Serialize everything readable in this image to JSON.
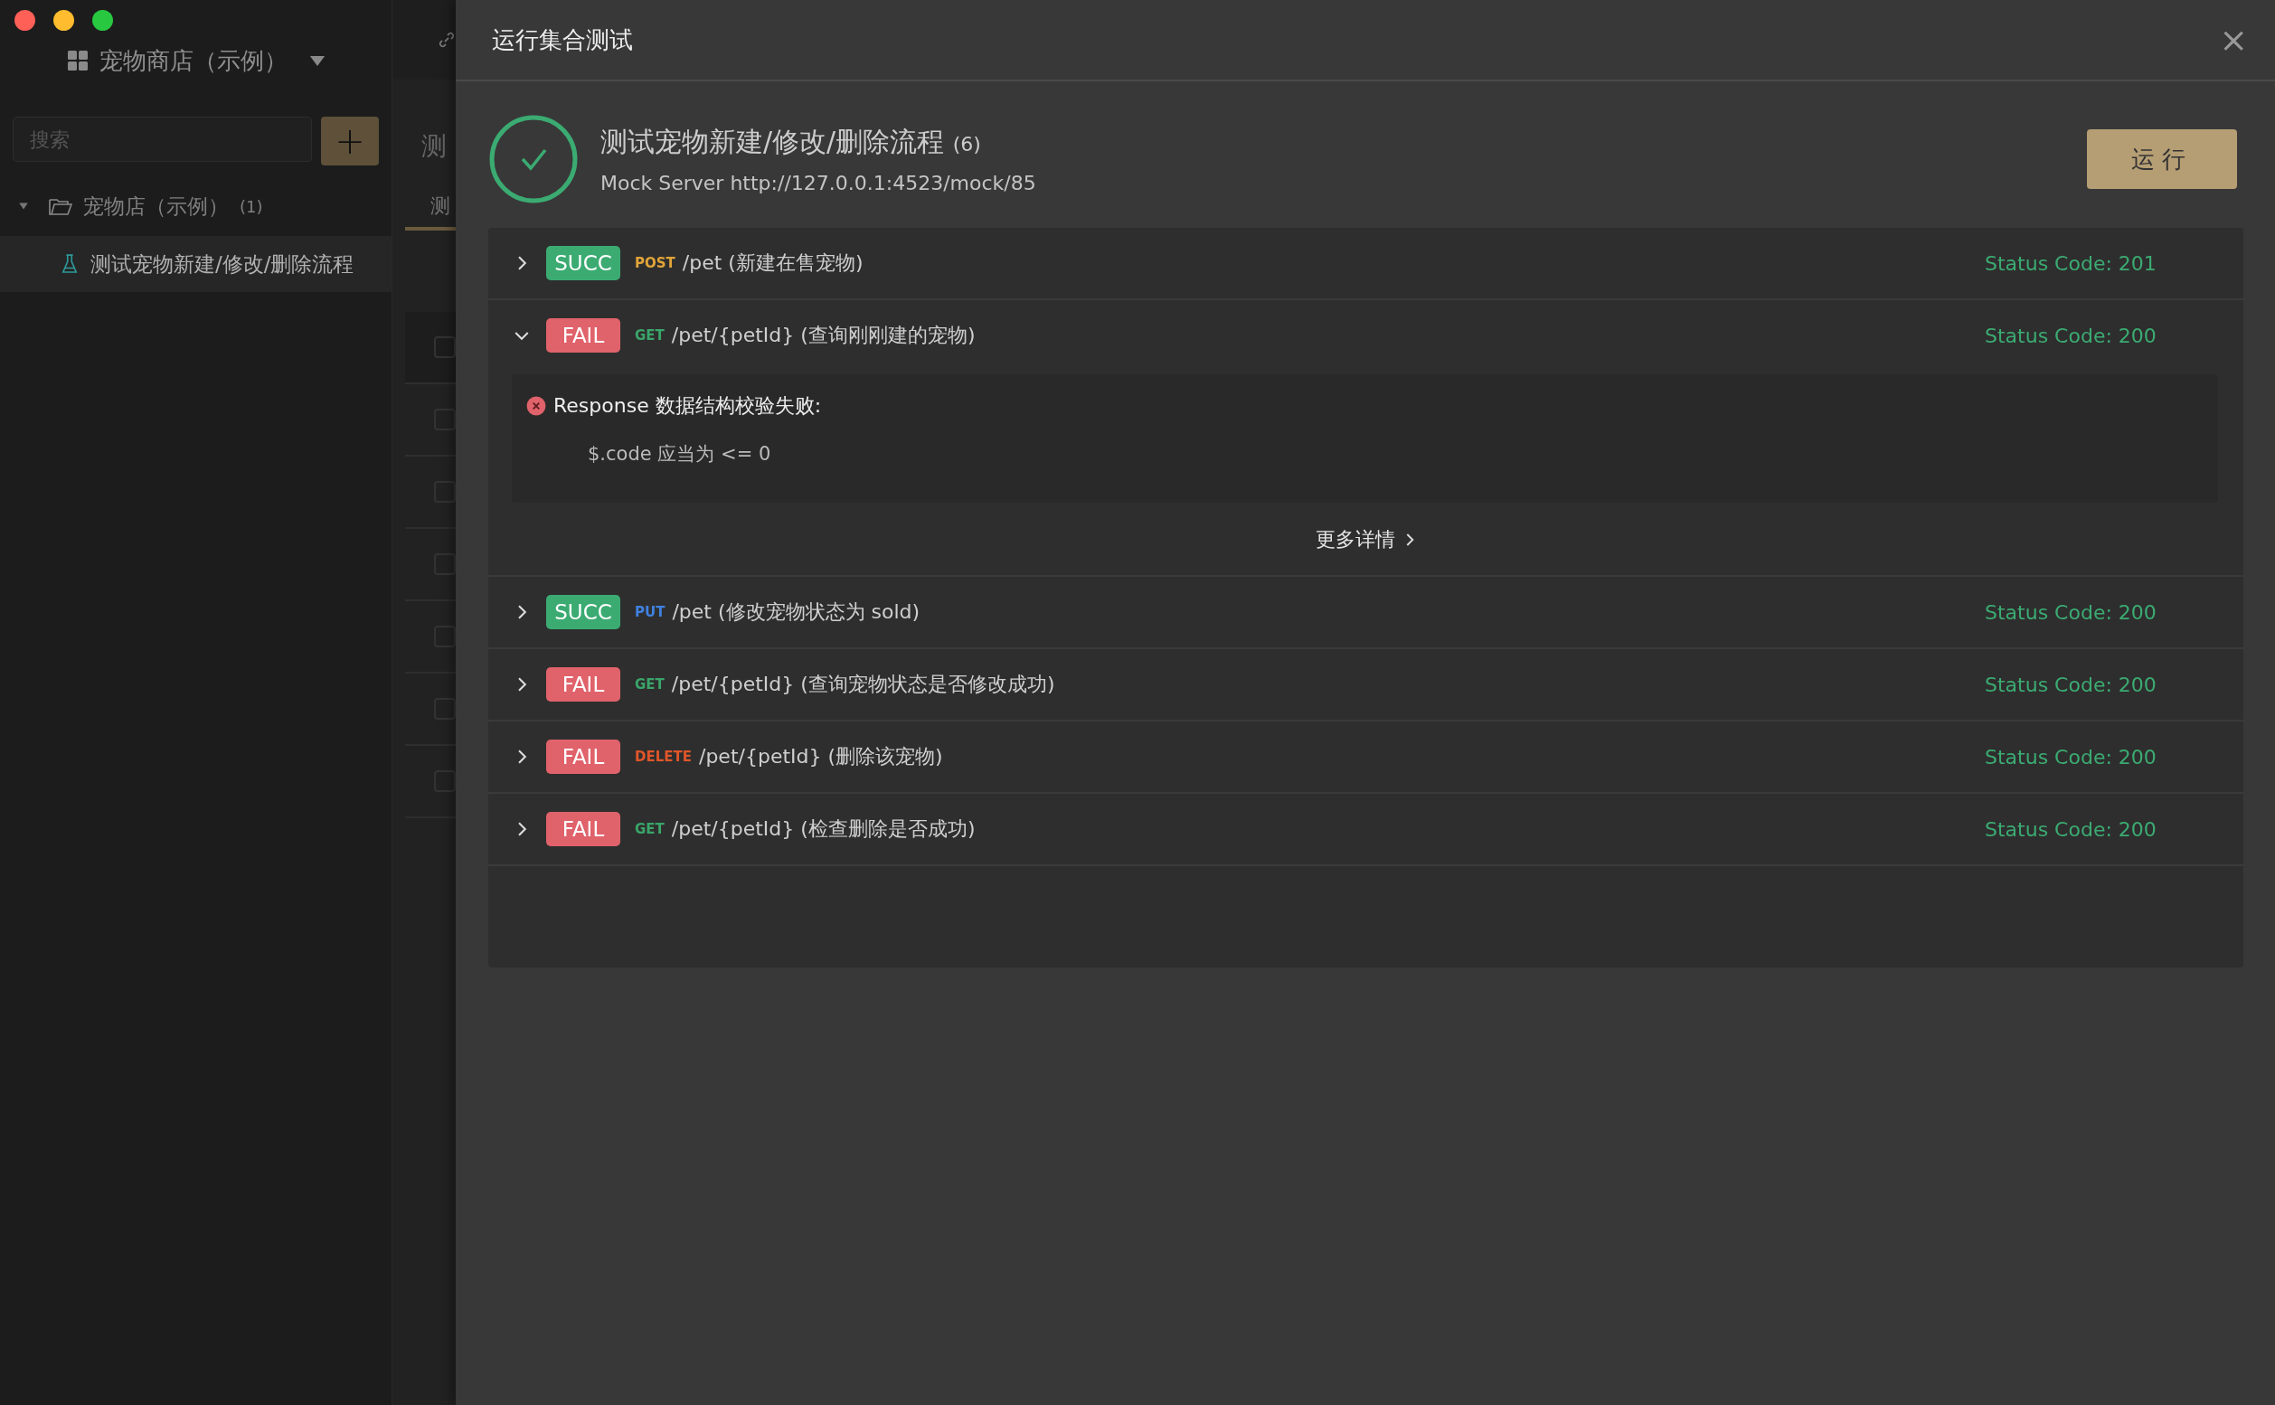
{
  "sidebar": {
    "project": "宠物商店（示例）",
    "search": {
      "placeholder": "搜索"
    },
    "add_button": "+",
    "tree": [
      {
        "label": "宠物店（示例）",
        "count": "(1)",
        "expanded": true,
        "children": [
          {
            "label": "测试宠物新建/修改/删除流程",
            "selected": true
          }
        ]
      }
    ]
  },
  "background": {
    "heading": "测",
    "tab": "测",
    "rows": [
      {
        "checked": false
      },
      {
        "checked": false
      },
      {
        "checked": false
      },
      {
        "checked": false
      },
      {
        "checked": false
      },
      {
        "checked": false
      },
      {
        "checked": false
      }
    ]
  },
  "modal": {
    "title": "运行集合测试",
    "close": "×",
    "suite": {
      "name": "测试宠物新建/修改/删除流程",
      "count": "(6)",
      "server": "Mock Server http://127.0.0.1:4523/mock/85"
    },
    "run_button": "运行",
    "results": [
      {
        "kind": "succ",
        "badge": "SUCC",
        "method": "POST",
        "color": "#e0a53a",
        "path": "/pet (新建在售宠物)",
        "status": "Status Code: 201",
        "expanded": false
      },
      {
        "kind": "fail",
        "badge": "FAIL",
        "method": "GET",
        "color": "#3aa56a",
        "path": "/pet/{petId} (查询刚刚建的宠物)",
        "status": "Status Code: 200",
        "expanded": true,
        "error": {
          "title": "Response 数据结构校验失败:",
          "message": "$.code 应当为 <= 0"
        },
        "more": "更多详情"
      },
      {
        "kind": "succ",
        "badge": "SUCC",
        "method": "PUT",
        "color": "#3f82e0",
        "path": "/pet (修改宠物状态为 sold)",
        "status": "Status Code: 200",
        "expanded": false
      },
      {
        "kind": "fail",
        "badge": "FAIL",
        "method": "GET",
        "color": "#3aa56a",
        "path": "/pet/{petId} (查询宠物状态是否修改成功)",
        "status": "Status Code: 200",
        "expanded": false
      },
      {
        "kind": "fail",
        "badge": "FAIL",
        "method": "DELETE",
        "color": "#e0562a",
        "path": "/pet/{petId} (删除该宠物)",
        "status": "Status Code: 200",
        "expanded": false
      },
      {
        "kind": "fail",
        "badge": "FAIL",
        "method": "GET",
        "color": "#3aa56a",
        "path": "/pet/{petId} (检查删除是否成功)",
        "status": "Status Code: 200",
        "expanded": false
      }
    ]
  }
}
